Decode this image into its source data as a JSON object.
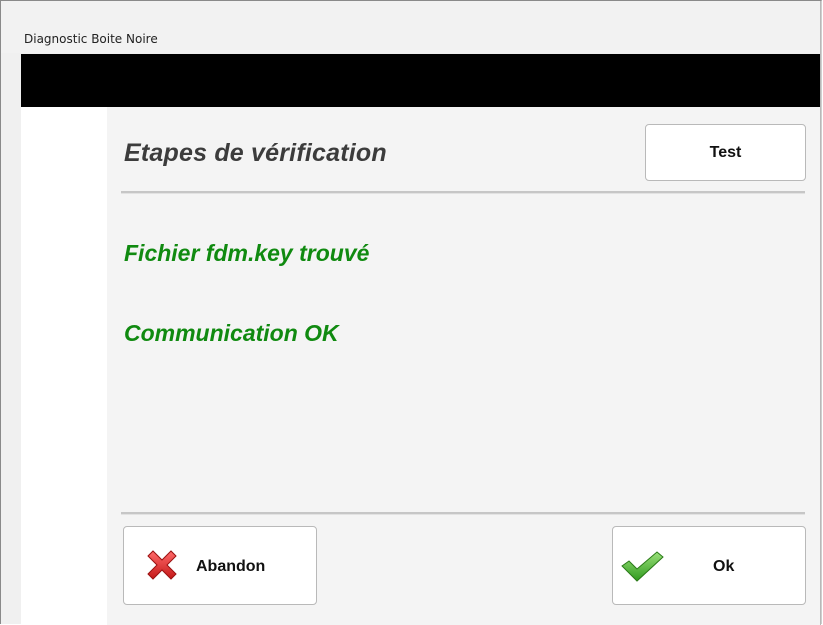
{
  "window": {
    "title": "Diagnostic Boite Noire"
  },
  "content": {
    "heading": "Etapes de vérification",
    "test_button": "Test",
    "status_lines": [
      "Fichier fdm.key trouvé",
      "Communication OK"
    ],
    "status_color": "#108a10"
  },
  "footer": {
    "abandon_label": "Abandon",
    "abandon_icon": "red-x-icon",
    "ok_label": "Ok",
    "ok_icon": "green-check-icon"
  }
}
